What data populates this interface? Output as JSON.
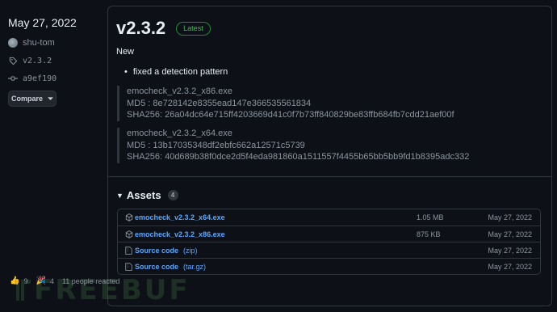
{
  "sidebar": {
    "date": "May 27, 2022",
    "author": "shu-tom",
    "tag": "v2.3.2",
    "commit": "a9ef190",
    "compare_label": "Compare"
  },
  "release": {
    "version": "v2.3.2",
    "latest_badge": "Latest",
    "new_label": "New",
    "bullet": "fixed a detection pattern",
    "quote1": [
      "emocheck_v2.3.2_x86.exe",
      "MD5 : 8e728142e8355ead147e366535561834",
      "SHA256: 26a04dc64e715ff4203669d41c0f7b73ff840829be83ffb684fb7cdd21aef00f"
    ],
    "quote2": [
      "emocheck_v2.3.2_x64.exe",
      "MD5 : 13b17035348df2ebfc662a12571c5739",
      "SHA256: 40d689b38f0dce2d5f4eda981860a1511557f4455b65bb5bb9fd1b8395adc332"
    ]
  },
  "assets": {
    "title": "Assets",
    "count": "4",
    "rows": [
      {
        "name": "emocheck_v2.3.2_x64.exe",
        "format": "",
        "size": "1.05 MB",
        "date": "May 27, 2022",
        "icon": "package-icon"
      },
      {
        "name": "emocheck_v2.3.2_x86.exe",
        "format": "",
        "size": "875 KB",
        "date": "May 27, 2022",
        "icon": "package-icon"
      },
      {
        "name": "Source code",
        "format": "(zip)",
        "size": "",
        "date": "May 27, 2022",
        "icon": "file-zip-icon"
      },
      {
        "name": "Source code",
        "format": "(tar.gz)",
        "size": "",
        "date": "May 27, 2022",
        "icon": "file-zip-icon"
      }
    ]
  },
  "reactions": {
    "thumbs_up": "9",
    "party": "4",
    "summary": "11 people reacted"
  },
  "watermark": "FREEBUF",
  "colors": {
    "background": "#0d1117",
    "border": "#30363d",
    "link": "#58a6ff",
    "latest_green": "#3fb950"
  }
}
